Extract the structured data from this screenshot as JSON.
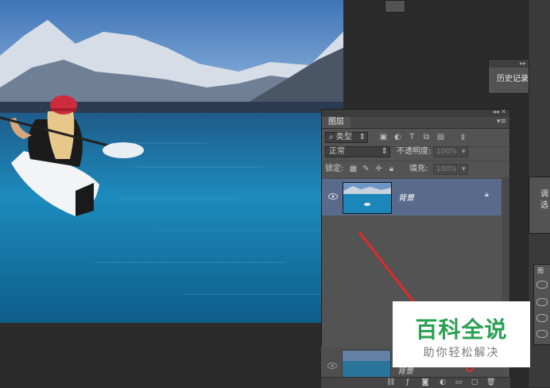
{
  "layers_panel": {
    "tab_label": "图层",
    "filter_label": "类型",
    "blend_mode": "正常",
    "opacity_label": "不透明度:",
    "opacity_value": "100%",
    "lock_label": "锁定:",
    "fill_label": "填充:",
    "fill_value": "100%",
    "layer": {
      "name": "背景"
    }
  },
  "history_panel": {
    "label": "历史记录"
  },
  "right_fragments": {
    "text_1": "调",
    "text_2": "选",
    "text_3": "图"
  },
  "ghost_layer": {
    "name": "背景"
  },
  "watermark": {
    "title": "百科全说",
    "subtitle": "助你轻松解决"
  },
  "colors": {
    "panel_bg": "#535353",
    "selected_layer": "#5a6a8a",
    "arrow": "#e02a2a",
    "watermark_green": "#2aa052"
  },
  "icons": [
    "eye-icon",
    "lock-icon",
    "history-icon",
    "filter-icon"
  ]
}
